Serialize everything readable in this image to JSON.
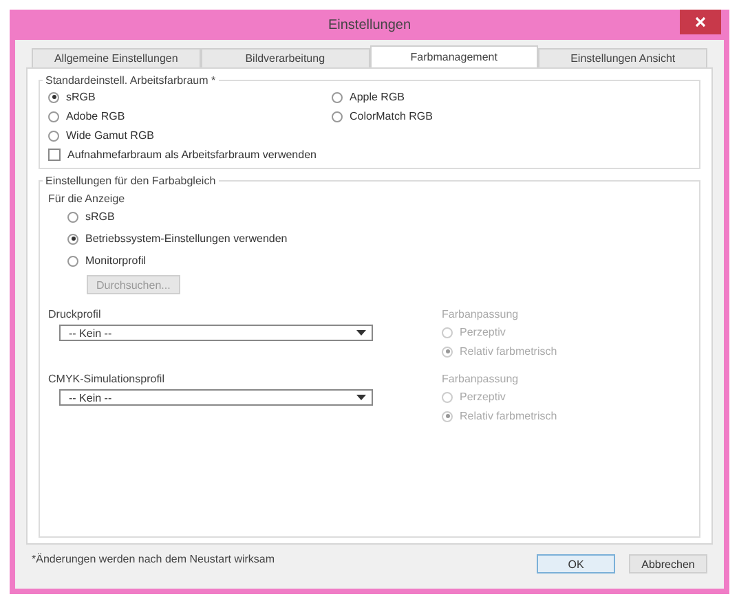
{
  "window": {
    "title": "Einstellungen"
  },
  "tabs": [
    {
      "label": "Allgemeine Einstellungen",
      "selected": false
    },
    {
      "label": "Bildverarbeitung",
      "selected": false
    },
    {
      "label": "Farbmanagement",
      "selected": true
    },
    {
      "label": "Einstellungen Ansicht",
      "selected": false
    }
  ],
  "workspace": {
    "title": "Standardeinstell. Arbeitsfarbraum *",
    "options": [
      {
        "label": "sRGB",
        "selected": true
      },
      {
        "label": "Apple RGB",
        "selected": false
      },
      {
        "label": "Adobe RGB",
        "selected": false
      },
      {
        "label": "ColorMatch RGB",
        "selected": false
      },
      {
        "label": "Wide Gamut RGB",
        "selected": false
      }
    ],
    "checkbox": {
      "label": "Aufnahmefarbraum als Arbeitsfarbraum verwenden",
      "checked": false
    }
  },
  "matching": {
    "title": "Einstellungen für den Farbabgleich",
    "display_label": "Für die Anzeige",
    "display_options": [
      {
        "label": "sRGB",
        "selected": false
      },
      {
        "label": "Betriebssystem-Einstellungen verwenden",
        "selected": true
      },
      {
        "label": "Monitorprofil",
        "selected": false
      }
    ],
    "browse_button": {
      "label": "Durchsuchen...",
      "disabled": true
    },
    "profiles": [
      {
        "label": "Druckprofil",
        "value": "-- Kein --",
        "intent_title": "Farbanpassung",
        "disabled": true,
        "intents": [
          {
            "label": "Perzeptiv",
            "selected": false
          },
          {
            "label": "Relativ farbmetrisch",
            "selected": true
          }
        ]
      },
      {
        "label": "CMYK-Simulationsprofil",
        "value": "-- Kein --",
        "intent_title": "Farbanpassung",
        "disabled": true,
        "intents": [
          {
            "label": "Perzeptiv",
            "selected": false
          },
          {
            "label": "Relativ farbmetrisch",
            "selected": true
          }
        ]
      }
    ]
  },
  "footer": {
    "note": "*Änderungen werden nach dem Neustart wirksam",
    "buttons": [
      "OK",
      "Abbrechen"
    ]
  }
}
